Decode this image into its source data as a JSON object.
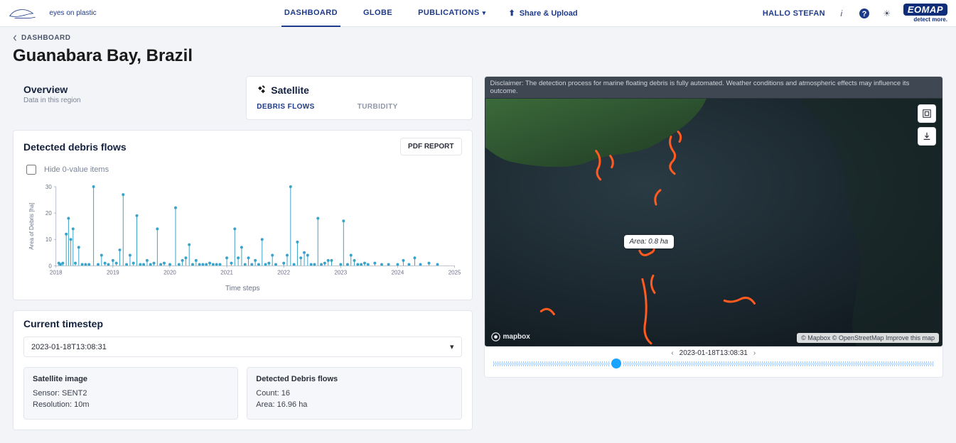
{
  "brand": {
    "name": "eyes on plastic"
  },
  "nav": {
    "dashboard": "DASHBOARD",
    "globe": "GLOBE",
    "publications": "PUBLICATIONS",
    "upload": "Share & Upload"
  },
  "user": {
    "greeting": "HALLO STEFAN"
  },
  "partner": {
    "logo_text": "EOMAP",
    "tagline": "detect more."
  },
  "breadcrumb": {
    "parent": "DASHBOARD"
  },
  "page_title": "Guanabara Bay, Brazil",
  "selectors": {
    "overview": {
      "title": "Overview",
      "sub": "Data in this region"
    },
    "satellite": {
      "title": "Satellite",
      "tabs": {
        "debris": "DEBRIS FLOWS",
        "turbidity": "TURBIDITY"
      }
    }
  },
  "debris_panel": {
    "title": "Detected debris flows",
    "pdf_button": "PDF REPORT",
    "hide_zero_label": "Hide 0-value items"
  },
  "chart_data": {
    "type": "scatter",
    "title": "Detected debris flows",
    "xlabel": "Time steps",
    "ylabel": "Area of Debris [ha]",
    "ylim": [
      0,
      30
    ],
    "xlim": [
      2018,
      2025
    ],
    "x_ticks": [
      2018,
      2019,
      2020,
      2021,
      2022,
      2023,
      2024,
      2025
    ],
    "y_ticks": [
      0,
      10,
      20,
      30
    ],
    "points": [
      {
        "x": 2018.05,
        "y": 1
      },
      {
        "x": 2018.08,
        "y": 0.5
      },
      {
        "x": 2018.12,
        "y": 1
      },
      {
        "x": 2018.18,
        "y": 12
      },
      {
        "x": 2018.22,
        "y": 18
      },
      {
        "x": 2018.26,
        "y": 10
      },
      {
        "x": 2018.3,
        "y": 14
      },
      {
        "x": 2018.34,
        "y": 1
      },
      {
        "x": 2018.4,
        "y": 7
      },
      {
        "x": 2018.46,
        "y": 0.5
      },
      {
        "x": 2018.52,
        "y": 0.5
      },
      {
        "x": 2018.58,
        "y": 0.5
      },
      {
        "x": 2018.66,
        "y": 31
      },
      {
        "x": 2018.74,
        "y": 0.5
      },
      {
        "x": 2018.8,
        "y": 4
      },
      {
        "x": 2018.86,
        "y": 1
      },
      {
        "x": 2018.92,
        "y": 0.5
      },
      {
        "x": 2019.0,
        "y": 2
      },
      {
        "x": 2019.06,
        "y": 1
      },
      {
        "x": 2019.12,
        "y": 6
      },
      {
        "x": 2019.18,
        "y": 27
      },
      {
        "x": 2019.24,
        "y": 0.5
      },
      {
        "x": 2019.3,
        "y": 4
      },
      {
        "x": 2019.36,
        "y": 1
      },
      {
        "x": 2019.42,
        "y": 19
      },
      {
        "x": 2019.48,
        "y": 0.5
      },
      {
        "x": 2019.54,
        "y": 0.5
      },
      {
        "x": 2019.6,
        "y": 2
      },
      {
        "x": 2019.66,
        "y": 0.5
      },
      {
        "x": 2019.72,
        "y": 1
      },
      {
        "x": 2019.78,
        "y": 14
      },
      {
        "x": 2019.84,
        "y": 0.5
      },
      {
        "x": 2019.9,
        "y": 1
      },
      {
        "x": 2020.0,
        "y": 0.5
      },
      {
        "x": 2020.1,
        "y": 22
      },
      {
        "x": 2020.16,
        "y": 0.5
      },
      {
        "x": 2020.22,
        "y": 2
      },
      {
        "x": 2020.28,
        "y": 3
      },
      {
        "x": 2020.34,
        "y": 8
      },
      {
        "x": 2020.4,
        "y": 0.5
      },
      {
        "x": 2020.46,
        "y": 2
      },
      {
        "x": 2020.52,
        "y": 0.5
      },
      {
        "x": 2020.58,
        "y": 0.5
      },
      {
        "x": 2020.64,
        "y": 0.5
      },
      {
        "x": 2020.7,
        "y": 1
      },
      {
        "x": 2020.76,
        "y": 0.5
      },
      {
        "x": 2020.82,
        "y": 0.5
      },
      {
        "x": 2020.88,
        "y": 0.5
      },
      {
        "x": 2021.0,
        "y": 3
      },
      {
        "x": 2021.08,
        "y": 1
      },
      {
        "x": 2021.14,
        "y": 14
      },
      {
        "x": 2021.2,
        "y": 3
      },
      {
        "x": 2021.26,
        "y": 7
      },
      {
        "x": 2021.32,
        "y": 0.5
      },
      {
        "x": 2021.38,
        "y": 3
      },
      {
        "x": 2021.44,
        "y": 0.5
      },
      {
        "x": 2021.5,
        "y": 2
      },
      {
        "x": 2021.56,
        "y": 0.5
      },
      {
        "x": 2021.62,
        "y": 10
      },
      {
        "x": 2021.68,
        "y": 0.5
      },
      {
        "x": 2021.74,
        "y": 1
      },
      {
        "x": 2021.8,
        "y": 4
      },
      {
        "x": 2021.86,
        "y": 0.5
      },
      {
        "x": 2022.0,
        "y": 1
      },
      {
        "x": 2022.06,
        "y": 4
      },
      {
        "x": 2022.12,
        "y": 32
      },
      {
        "x": 2022.18,
        "y": 0.5
      },
      {
        "x": 2022.24,
        "y": 9
      },
      {
        "x": 2022.3,
        "y": 3
      },
      {
        "x": 2022.36,
        "y": 5
      },
      {
        "x": 2022.42,
        "y": 4
      },
      {
        "x": 2022.48,
        "y": 0.5
      },
      {
        "x": 2022.54,
        "y": 0.5
      },
      {
        "x": 2022.6,
        "y": 18
      },
      {
        "x": 2022.66,
        "y": 0.5
      },
      {
        "x": 2022.72,
        "y": 1
      },
      {
        "x": 2022.78,
        "y": 2
      },
      {
        "x": 2022.84,
        "y": 2
      },
      {
        "x": 2023.0,
        "y": 0.5
      },
      {
        "x": 2023.05,
        "y": 17
      },
      {
        "x": 2023.12,
        "y": 0.5
      },
      {
        "x": 2023.18,
        "y": 4
      },
      {
        "x": 2023.24,
        "y": 2
      },
      {
        "x": 2023.3,
        "y": 0.5
      },
      {
        "x": 2023.36,
        "y": 0.5
      },
      {
        "x": 2023.42,
        "y": 1
      },
      {
        "x": 2023.48,
        "y": 0.5
      },
      {
        "x": 2023.6,
        "y": 1
      },
      {
        "x": 2023.72,
        "y": 0.5
      },
      {
        "x": 2023.84,
        "y": 0.5
      },
      {
        "x": 2024.0,
        "y": 0.5
      },
      {
        "x": 2024.1,
        "y": 2
      },
      {
        "x": 2024.2,
        "y": 0.5
      },
      {
        "x": 2024.3,
        "y": 3
      },
      {
        "x": 2024.4,
        "y": 0.5
      },
      {
        "x": 2024.55,
        "y": 1
      },
      {
        "x": 2024.7,
        "y": 0.5
      }
    ]
  },
  "timestep": {
    "title": "Current timestep",
    "selected": "2023-01-18T13:08:31",
    "satellite_card": {
      "title": "Satellite image",
      "sensor_label": "Sensor:",
      "sensor_value": "SENT2",
      "resolution_label": "Resolution:",
      "resolution_value": "10m"
    },
    "debris_card": {
      "title": "Detected Debris flows",
      "count_label": "Count:",
      "count_value": "16",
      "area_label": "Area:",
      "area_value": "16.96 ha"
    }
  },
  "map": {
    "disclaimer": "Disclaimer: The detection process for marine floating debris is fully automated. Weather conditions and atmospheric effects may influence its outcome.",
    "tooltip": "Area: 0.8 ha",
    "mapbox": "mapbox",
    "attribution": "© Mapbox © OpenStreetMap Improve this map",
    "timeline_label": "2023-01-18T13:08:31",
    "slider_position_pct": 28
  }
}
